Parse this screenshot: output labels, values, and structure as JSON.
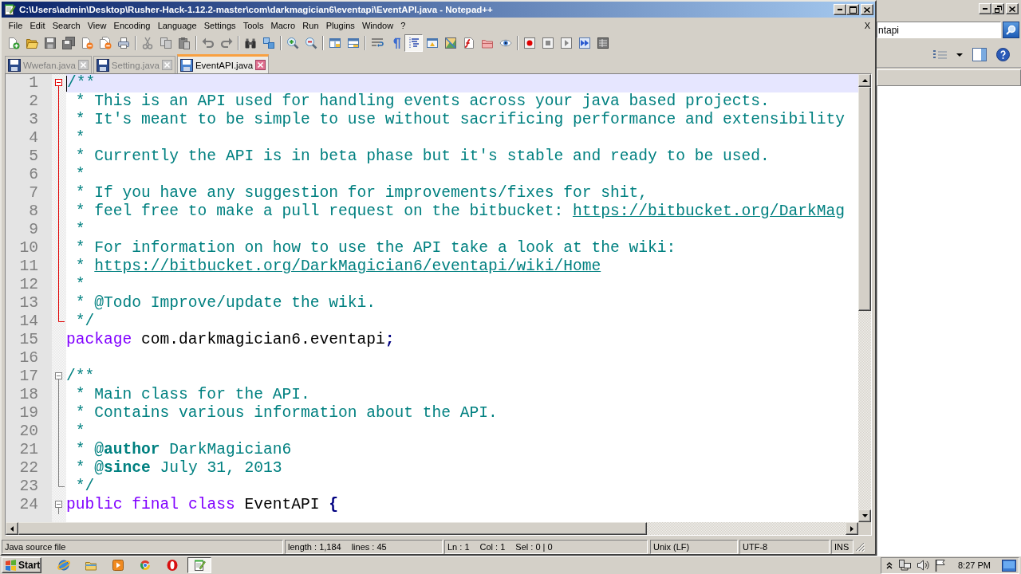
{
  "window": {
    "title": "C:\\Users\\admin\\Desktop\\Rusher-Hack-1.12.2-master\\com\\darkmagician6\\eventapi\\EventAPI.java - Notepad++"
  },
  "menu": [
    "File",
    "Edit",
    "Search",
    "View",
    "Encoding",
    "Language",
    "Settings",
    "Tools",
    "Macro",
    "Run",
    "Plugins",
    "Window",
    "?"
  ],
  "menu_close": "X",
  "toolbar": [
    {
      "kind": "new",
      "disabled": false,
      "pressed": false
    },
    {
      "kind": "open",
      "disabled": false,
      "pressed": false
    },
    {
      "kind": "save",
      "disabled": true,
      "pressed": false
    },
    {
      "kind": "saveall",
      "disabled": true,
      "pressed": false
    },
    {
      "kind": "close",
      "disabled": false,
      "pressed": false
    },
    {
      "kind": "closeall",
      "disabled": false,
      "pressed": false
    },
    {
      "kind": "print",
      "disabled": false,
      "pressed": false
    },
    {
      "kind": "separator"
    },
    {
      "kind": "cut",
      "disabled": true,
      "pressed": false
    },
    {
      "kind": "copy",
      "disabled": true,
      "pressed": false
    },
    {
      "kind": "paste",
      "disabled": true,
      "pressed": false
    },
    {
      "kind": "separator"
    },
    {
      "kind": "undo",
      "disabled": true,
      "pressed": false
    },
    {
      "kind": "redo",
      "disabled": true,
      "pressed": false
    },
    {
      "kind": "separator"
    },
    {
      "kind": "find",
      "disabled": false,
      "pressed": false
    },
    {
      "kind": "replace",
      "disabled": false,
      "pressed": false
    },
    {
      "kind": "separator"
    },
    {
      "kind": "zoomin",
      "disabled": false,
      "pressed": false
    },
    {
      "kind": "zoomout",
      "disabled": false,
      "pressed": false
    },
    {
      "kind": "separator"
    },
    {
      "kind": "syncv",
      "disabled": false,
      "pressed": false
    },
    {
      "kind": "synch",
      "disabled": false,
      "pressed": false
    },
    {
      "kind": "separator"
    },
    {
      "kind": "wrap",
      "disabled": false,
      "pressed": false
    },
    {
      "kind": "allchars",
      "disabled": false,
      "pressed": false
    },
    {
      "kind": "indent",
      "disabled": false,
      "pressed": true
    },
    {
      "kind": "userlang",
      "disabled": false,
      "pressed": false
    },
    {
      "kind": "docmap",
      "disabled": false,
      "pressed": false
    },
    {
      "kind": "funclist",
      "disabled": false,
      "pressed": false
    },
    {
      "kind": "workspace",
      "disabled": false,
      "pressed": false
    },
    {
      "kind": "monitor",
      "disabled": false,
      "pressed": false
    },
    {
      "kind": "separator"
    },
    {
      "kind": "record",
      "disabled": false,
      "pressed": false
    },
    {
      "kind": "stop",
      "disabled": true,
      "pressed": false
    },
    {
      "kind": "play",
      "disabled": true,
      "pressed": false
    },
    {
      "kind": "playmulti",
      "disabled": false,
      "pressed": false
    },
    {
      "kind": "savemacro",
      "disabled": true,
      "pressed": false
    }
  ],
  "tabs": [
    {
      "label": "Wwefan.java",
      "selected": false
    },
    {
      "label": "Setting.java",
      "selected": false
    },
    {
      "label": "EventAPI.java",
      "selected": true
    }
  ],
  "editor": {
    "lines": [
      {
        "number": "1",
        "current": true,
        "fold": {
          "kind": "head",
          "active": true
        },
        "tokens": [
          {
            "kind": "comment",
            "text": "/**"
          }
        ]
      },
      {
        "number": "2",
        "current": false,
        "fold": {
          "kind": "body",
          "active": true
        },
        "tokens": [
          {
            "kind": "comment",
            "text": " * This is an API used for handling events across your java based projects."
          }
        ]
      },
      {
        "number": "3",
        "current": false,
        "fold": {
          "kind": "body",
          "active": true
        },
        "tokens": [
          {
            "kind": "comment",
            "text": " * It's meant to be simple to use without sacrificing performance and extensibility"
          }
        ]
      },
      {
        "number": "4",
        "current": false,
        "fold": {
          "kind": "body",
          "active": true
        },
        "tokens": [
          {
            "kind": "comment",
            "text": " *"
          }
        ]
      },
      {
        "number": "5",
        "current": false,
        "fold": {
          "kind": "body",
          "active": true
        },
        "tokens": [
          {
            "kind": "comment",
            "text": " * Currently the API is in beta phase but it's stable and ready to be used."
          }
        ]
      },
      {
        "number": "6",
        "current": false,
        "fold": {
          "kind": "body",
          "active": true
        },
        "tokens": [
          {
            "kind": "comment",
            "text": " *"
          }
        ]
      },
      {
        "number": "7",
        "current": false,
        "fold": {
          "kind": "body",
          "active": true
        },
        "tokens": [
          {
            "kind": "comment",
            "text": " * If you have any suggestion for improvements/fixes for shit,"
          }
        ]
      },
      {
        "number": "8",
        "current": false,
        "fold": {
          "kind": "body",
          "active": true
        },
        "tokens": [
          {
            "kind": "comment",
            "text": " * feel free to make a pull request on the bitbucket: "
          },
          {
            "kind": "url",
            "text": "https://bitbucket.org/DarkMag"
          }
        ]
      },
      {
        "number": "9",
        "current": false,
        "fold": {
          "kind": "body",
          "active": true
        },
        "tokens": [
          {
            "kind": "comment",
            "text": " *"
          }
        ]
      },
      {
        "number": "10",
        "current": false,
        "fold": {
          "kind": "body",
          "active": true
        },
        "tokens": [
          {
            "kind": "comment",
            "text": " * For information on how to use the API take a look at the wiki:"
          }
        ]
      },
      {
        "number": "11",
        "current": false,
        "fold": {
          "kind": "body",
          "active": true
        },
        "tokens": [
          {
            "kind": "comment",
            "text": " * "
          },
          {
            "kind": "url",
            "text": "https://bitbucket.org/DarkMagician6/eventapi/wiki/Home"
          }
        ]
      },
      {
        "number": "12",
        "current": false,
        "fold": {
          "kind": "body",
          "active": true
        },
        "tokens": [
          {
            "kind": "comment",
            "text": " *"
          }
        ]
      },
      {
        "number": "13",
        "current": false,
        "fold": {
          "kind": "body",
          "active": true
        },
        "tokens": [
          {
            "kind": "comment",
            "text": " * @Todo Improve/update the wiki."
          }
        ]
      },
      {
        "number": "14",
        "current": false,
        "fold": {
          "kind": "tail",
          "active": true
        },
        "tokens": [
          {
            "kind": "comment",
            "text": " */"
          }
        ]
      },
      {
        "number": "15",
        "current": false,
        "tokens": [
          {
            "kind": "keyword",
            "text": "package"
          },
          {
            "kind": "plain",
            "text": " com.darkmagician6.eventapi"
          },
          {
            "kind": "operator",
            "text": ";"
          }
        ]
      },
      {
        "number": "16",
        "current": false
      },
      {
        "number": "17",
        "current": false,
        "fold": {
          "kind": "head",
          "active": false
        },
        "tokens": [
          {
            "kind": "comment",
            "text": "/**"
          }
        ]
      },
      {
        "number": "18",
        "current": false,
        "fold": {
          "kind": "body",
          "active": false
        },
        "tokens": [
          {
            "kind": "comment",
            "text": " * Main class for the API."
          }
        ]
      },
      {
        "number": "19",
        "current": false,
        "fold": {
          "kind": "body",
          "active": false
        },
        "tokens": [
          {
            "kind": "comment",
            "text": " * Contains various information about the API."
          }
        ]
      },
      {
        "number": "20",
        "current": false,
        "fold": {
          "kind": "body",
          "active": false
        },
        "tokens": [
          {
            "kind": "comment",
            "text": " *"
          }
        ]
      },
      {
        "number": "21",
        "current": false,
        "fold": {
          "kind": "body",
          "active": false
        },
        "tokens": [
          {
            "kind": "comment",
            "text": " * @"
          },
          {
            "kind": "tag",
            "text": "author"
          },
          {
            "kind": "comment",
            "text": " DarkMagician6"
          }
        ]
      },
      {
        "number": "22",
        "current": false,
        "fold": {
          "kind": "body",
          "active": false
        },
        "tokens": [
          {
            "kind": "comment",
            "text": " * @"
          },
          {
            "kind": "tag",
            "text": "since"
          },
          {
            "kind": "comment",
            "text": " July 31, 2013"
          }
        ]
      },
      {
        "number": "23",
        "current": false,
        "fold": {
          "kind": "tail",
          "active": false
        },
        "tokens": [
          {
            "kind": "comment",
            "text": " */"
          }
        ]
      },
      {
        "number": "24",
        "current": false,
        "fold": {
          "kind": "head",
          "active": false
        },
        "tokens": [
          {
            "kind": "keyword",
            "text": "public"
          },
          {
            "kind": "keyword",
            "text": " final"
          },
          {
            "kind": "keyword",
            "text": " class"
          },
          {
            "kind": "plain",
            "text": " EventAPI "
          },
          {
            "kind": "operator",
            "text": "{"
          }
        ]
      }
    ]
  },
  "status_bar": {
    "file_type": "Java source file",
    "length": "length : 1,184",
    "lines": "lines : 45",
    "line": "Ln : 1",
    "column": "Col : 1",
    "selection": "Sel : 0 | 0",
    "line_ending": "Unix (LF)",
    "encoding": "UTF-8",
    "mode": "INS"
  },
  "explorer": {
    "search": {
      "value": "ntapi"
    }
  },
  "taskbar": {
    "start": "Start",
    "apps": [
      {
        "kind": "globe",
        "selected": false
      },
      {
        "kind": "folder",
        "selected": false
      },
      {
        "kind": "media",
        "selected": false
      },
      {
        "kind": "browser",
        "selected": false
      },
      {
        "kind": "ring",
        "selected": false
      },
      {
        "kind": "notepad",
        "selected": true
      }
    ],
    "clock": "8:27 PM"
  }
}
